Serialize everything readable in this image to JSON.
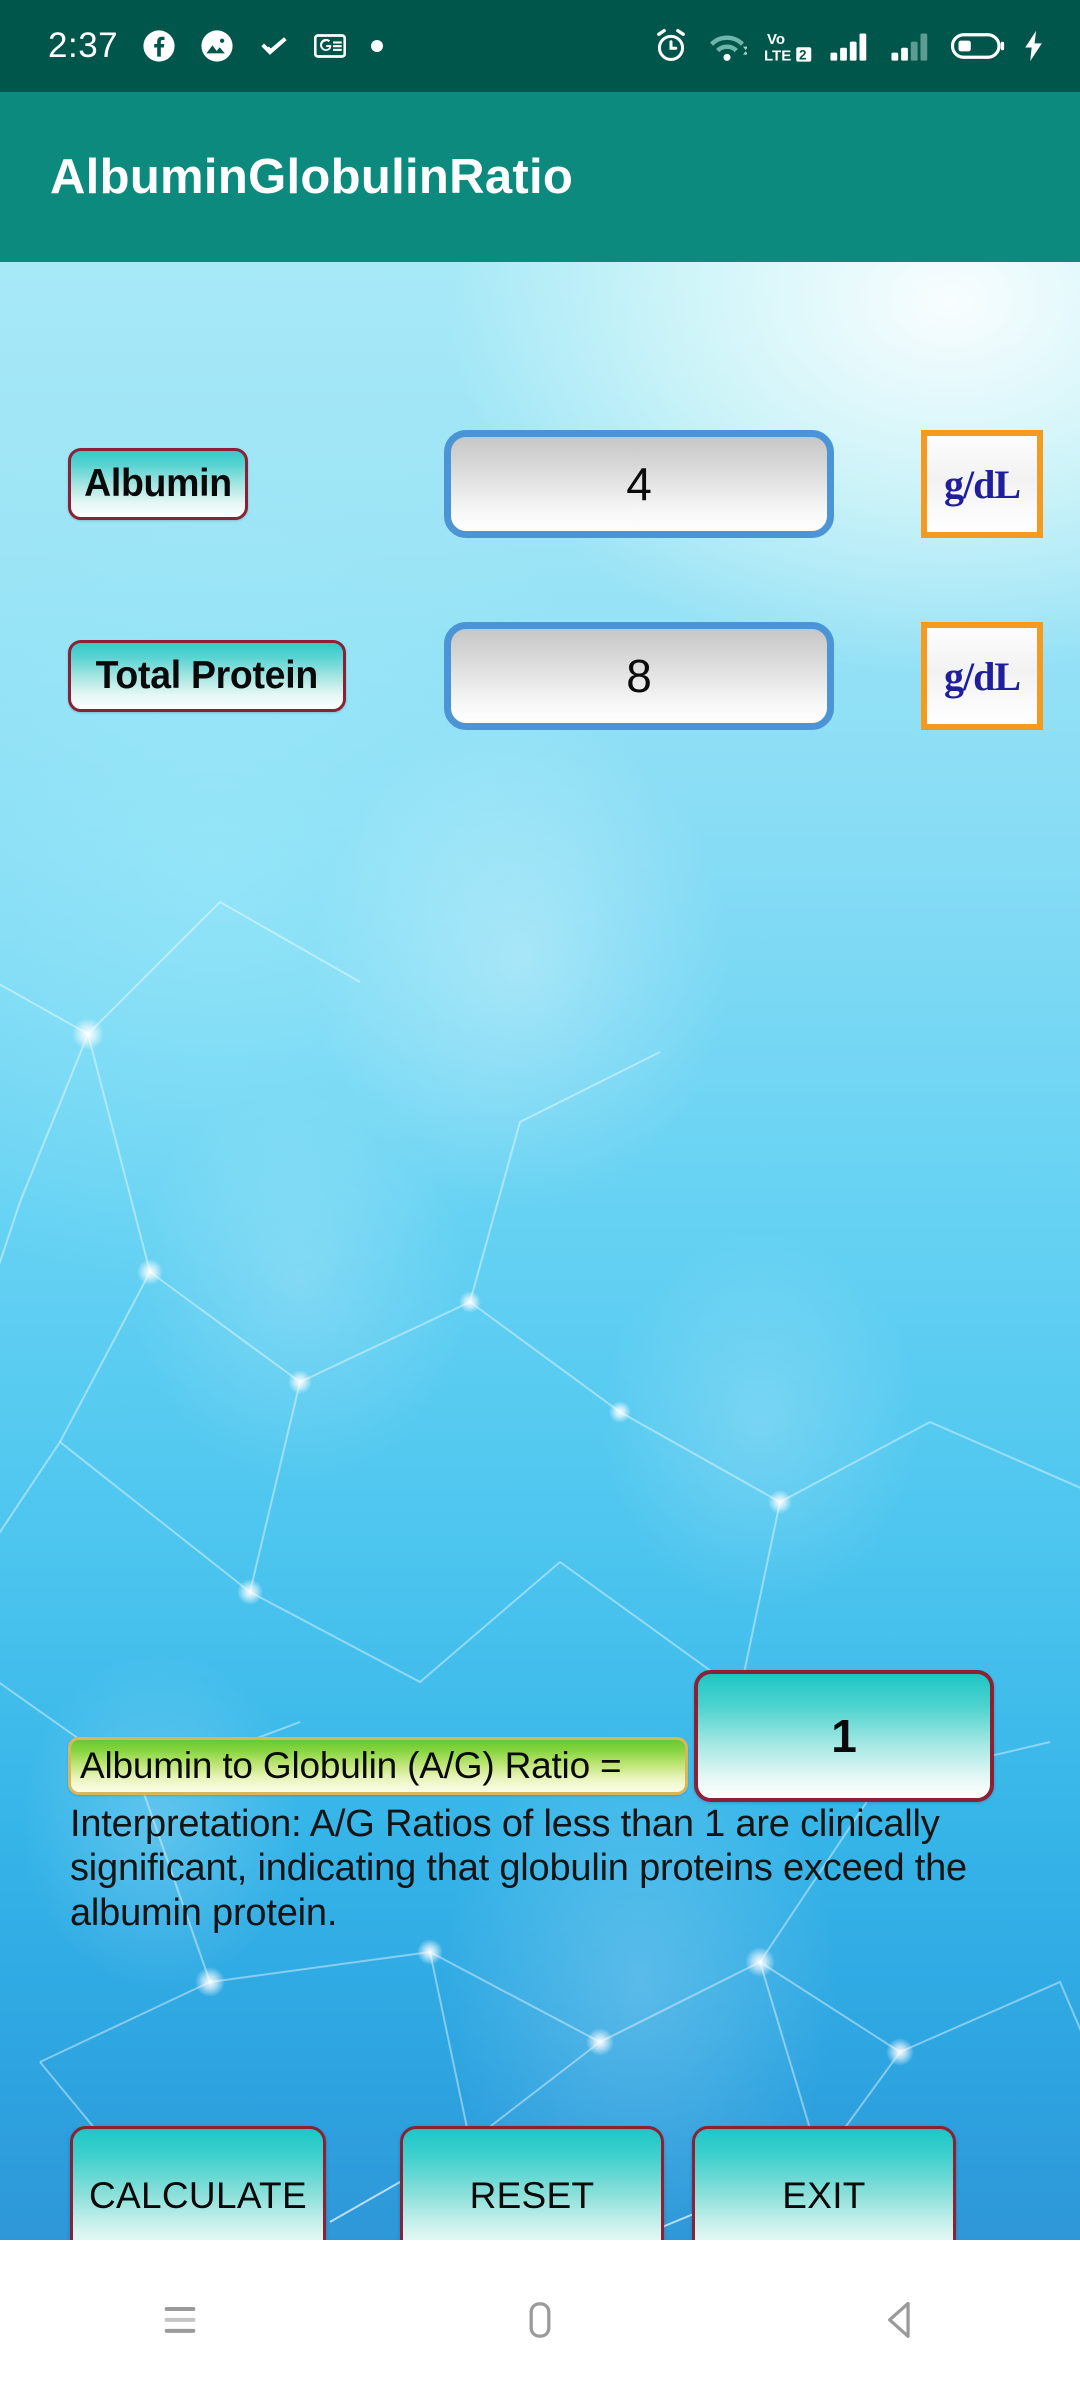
{
  "status_bar": {
    "time": "2:37",
    "left_icons": [
      "facebook-icon",
      "gallery-icon",
      "checkmark-icon",
      "google-news-icon",
      "dot-icon"
    ],
    "right_icons": [
      "alarm-icon",
      "wifi-icon",
      "volte2-icon",
      "signal-sim1-icon",
      "signal-sim2-icon",
      "battery-icon",
      "charging-bolt-icon"
    ],
    "volte_label": "Vo",
    "lte_label": "LTE",
    "sim_label": "2",
    "background_color": "#00564B"
  },
  "app_bar": {
    "title": "AlbuminGlobulinRatio",
    "background_color": "#0B8A7D",
    "title_color": "#FFFFFF"
  },
  "form": {
    "fields": [
      {
        "label": "Albumin",
        "value": "4",
        "unit": "g/dL"
      },
      {
        "label": "Total Protein",
        "value": "8",
        "unit": "g/dL"
      }
    ],
    "input_border_color": "#4B94D6",
    "unit_border_color": "#F59A1E",
    "unit_text_color": "#1F1F9E",
    "label_border_color": "#8B2135"
  },
  "result": {
    "ratio_label": "Albumin to Globulin (A/G) Ratio =",
    "ratio_value": "1",
    "interpretation": "Interpretation: A/G Ratios of less than 1 are clinically significant, indicating that globulin proteins exceed the albumin protein.",
    "label_gradient_top": "#67C92F",
    "label_border_color": "#D9B65C",
    "box_gradient_top": "#1DC6C6",
    "box_border_color": "#8B2135"
  },
  "actions": {
    "calculate_label": "CALCULATE",
    "reset_label": "RESET",
    "exit_label": "EXIT"
  },
  "nav_bar": {
    "recents_icon": "recents-icon",
    "home_icon": "home-icon",
    "back_icon": "back-icon"
  }
}
